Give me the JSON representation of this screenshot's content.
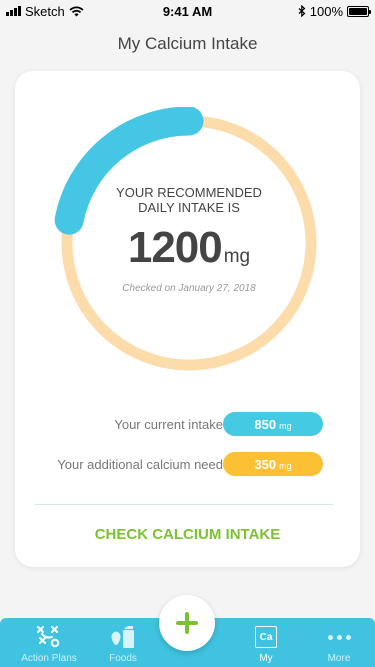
{
  "status_bar": {
    "carrier": "Sketch",
    "time": "9:41 AM",
    "battery": "100%"
  },
  "header": {
    "title": "My Calcium Intake"
  },
  "gauge": {
    "caption": "YOUR RECOMMENDED DAILY INTAKE IS",
    "value": "1200",
    "unit": "mg",
    "checked_date": "Checked on January 27, 2018",
    "progress_fraction": 0.22,
    "track_color": "#fddcab",
    "progress_color": "#45c6e4"
  },
  "intake": {
    "current": {
      "label": "Your current intake",
      "value": "850",
      "unit": "mg",
      "color": "#45cae4"
    },
    "additional": {
      "label": "Your additional calcium need",
      "value": "350",
      "unit": "mg",
      "color": "#fcc035"
    }
  },
  "actions": {
    "check_label": "CHECK CALCIUM INTAKE",
    "check_color": "#7cc230"
  },
  "tab_bar": {
    "color": "#3fc3e0",
    "items": [
      {
        "label": "Action Plans",
        "icon": "action-plans-icon"
      },
      {
        "label": "Foods",
        "icon": "foods-icon"
      },
      {
        "label": "My",
        "icon": "calcium-ca-icon",
        "ca_text": "Ca"
      },
      {
        "label": "More",
        "icon": "more-dots-icon"
      }
    ],
    "add_icon": "plus-icon",
    "add_color": "#7cc230"
  }
}
